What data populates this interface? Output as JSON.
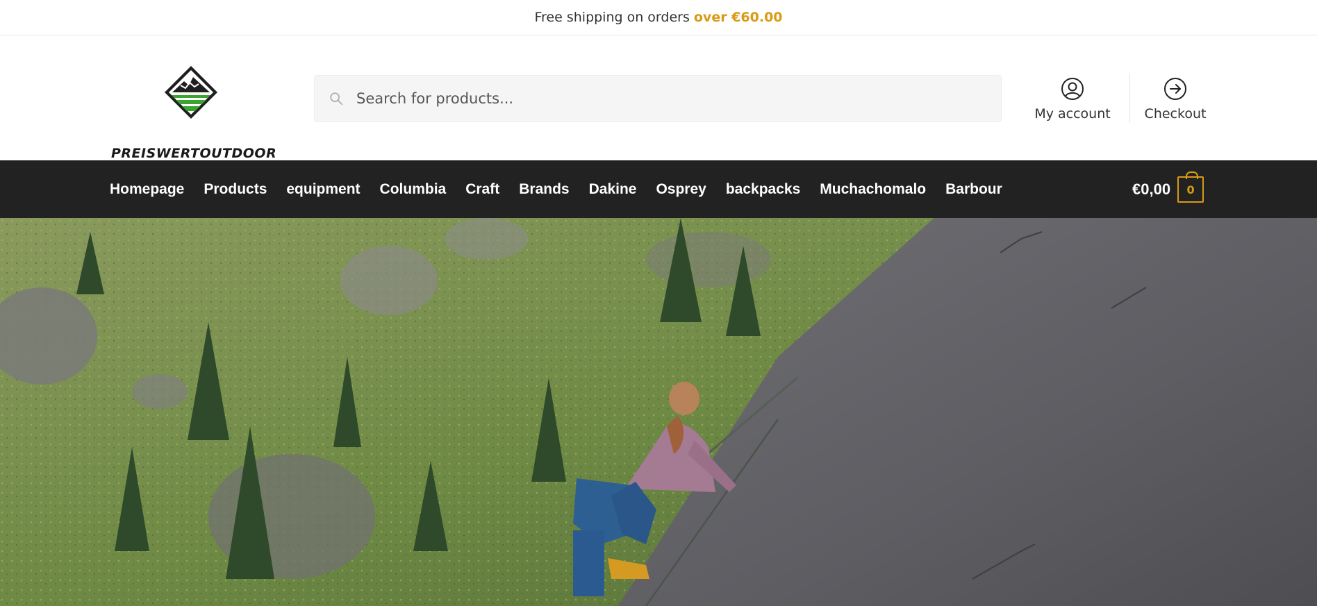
{
  "promo": {
    "text": "Free shipping on orders",
    "accent": "over €60.00",
    "accent_color": "#d99a16"
  },
  "brand": {
    "name": "PREISWERTOUTDOOR"
  },
  "search": {
    "placeholder": "Search for products..."
  },
  "header_links": {
    "account_label": "My account",
    "checkout_label": "Checkout"
  },
  "nav": {
    "items": [
      {
        "label": "Homepage"
      },
      {
        "label": "Products"
      },
      {
        "label": "equipment"
      },
      {
        "label": "Columbia"
      },
      {
        "label": "Craft"
      },
      {
        "label": "Brands"
      },
      {
        "label": "Dakine"
      },
      {
        "label": "Osprey"
      },
      {
        "label": "backpacks"
      },
      {
        "label": "Muchachomalo"
      },
      {
        "label": "Barbour"
      }
    ],
    "background": "#222222"
  },
  "cart": {
    "total": "€0,00",
    "count": "0"
  },
  "icons": {
    "search": "search-icon",
    "account": "user-circle-icon",
    "checkout": "arrow-right-circle-icon",
    "cart": "shopping-bag-icon"
  }
}
